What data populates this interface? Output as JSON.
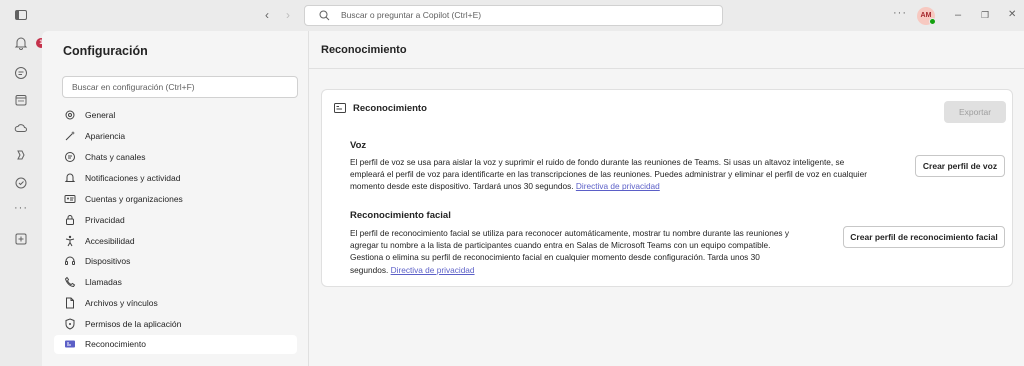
{
  "titlebar": {
    "search_placeholder": "Buscar o preguntar a Copilot (Ctrl+E)",
    "more_label": "···",
    "avatar_initials": "AM",
    "nav_back": "‹",
    "nav_forward": "›",
    "minimize": "–",
    "restore": "❐",
    "close": "✕"
  },
  "rail": {
    "activity_badge": "1",
    "more_label": "···"
  },
  "settings": {
    "title": "Configuración",
    "search_placeholder": "Buscar en configuración (Ctrl+F)",
    "items": [
      {
        "label": "General",
        "icon": "gear-icon"
      },
      {
        "label": "Apariencia",
        "icon": "wand-icon"
      },
      {
        "label": "Chats y canales",
        "icon": "chat-icon"
      },
      {
        "label": "Notificaciones y actividad",
        "icon": "bell-icon"
      },
      {
        "label": "Cuentas y organizaciones",
        "icon": "id-card-icon"
      },
      {
        "label": "Privacidad",
        "icon": "lock-icon"
      },
      {
        "label": "Accesibilidad",
        "icon": "accessibility-icon"
      },
      {
        "label": "Dispositivos",
        "icon": "headset-icon"
      },
      {
        "label": "Llamadas",
        "icon": "phone-icon"
      },
      {
        "label": "Archivos y vínculos",
        "icon": "document-icon"
      },
      {
        "label": "Permisos de la aplicación",
        "icon": "shield-icon"
      },
      {
        "label": "Reconocimiento",
        "icon": "recognition-icon"
      }
    ]
  },
  "main": {
    "header": "Reconocimiento",
    "card_title": "Reconocimiento",
    "export_label": "Exportar",
    "voice": {
      "title": "Voz",
      "line1": "El perfil de voz se usa para aislar la voz y suprimir el ruido de fondo durante las reuniones de Teams. Si usas un altavoz inteligente, se",
      "line2": "empleará el perfil de voz para identificarte en las transcripciones de las reuniones. Puedes administrar y eliminar el perfil de voz en cualquier",
      "line3": "momento desde este dispositivo. Tardará unos 30 segundos.",
      "link": "Directiva de privacidad",
      "button": "Crear perfil de voz"
    },
    "face": {
      "title": "Reconocimiento facial",
      "line1": "El perfil de reconocimiento facial se utiliza para reconocer automáticamente, mostrar tu nombre durante las reuniones y",
      "line2": "agregar tu nombre a la lista de participantes cuando entra en Salas de Microsoft Teams con un equipo compatible.",
      "line3": "Gestiona o elimina su perfil de reconocimiento facial en cualquier momento desde configuración. Tarda unos 30",
      "line4": "segundos.",
      "link": "Directiva de privacidad",
      "button": "Crear perfil de reconocimiento facial"
    }
  },
  "colors": {
    "accent": "#5b5fc7",
    "badge": "#c4314b",
    "presence": "#13a10e"
  }
}
